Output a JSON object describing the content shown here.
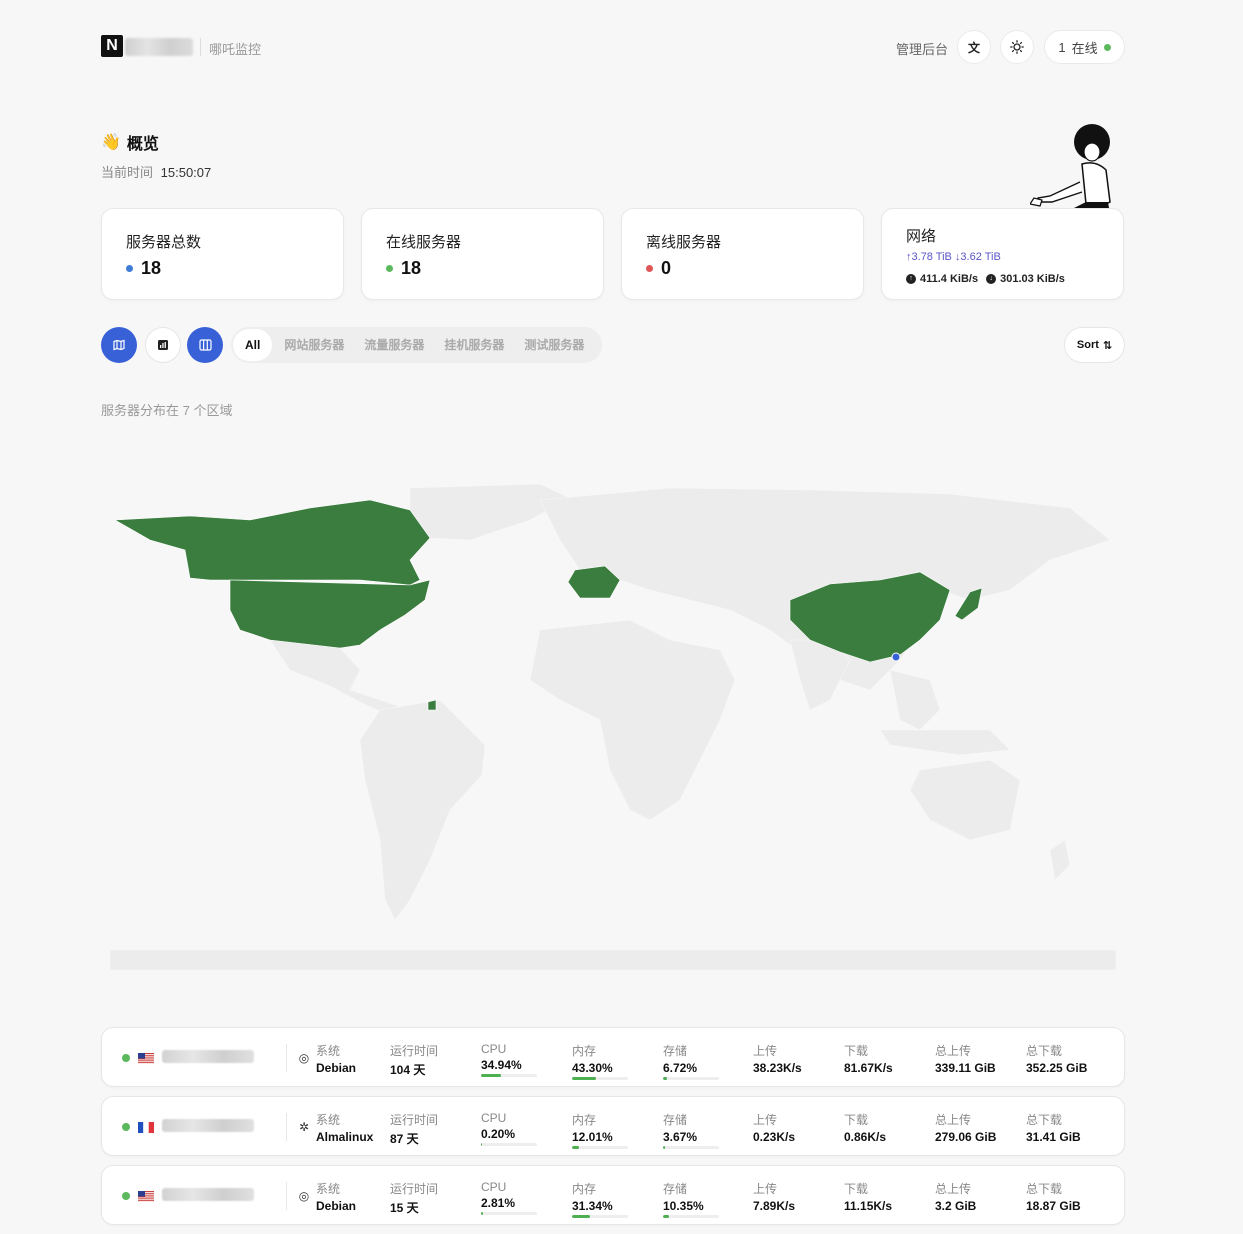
{
  "header": {
    "logo_letter": "N",
    "subtitle": "哪吒监控",
    "admin_label": "管理后台",
    "online_count": "1",
    "online_label": "在线"
  },
  "overview": {
    "emoji": "👋",
    "title": "概览",
    "time_label": "当前时间",
    "time_value": "15:50:07"
  },
  "stats": {
    "total": {
      "label": "服务器总数",
      "value": "18",
      "color": "#3e7bd6"
    },
    "online": {
      "label": "在线服务器",
      "value": "18",
      "color": "#5cb85c"
    },
    "offline": {
      "label": "离线服务器",
      "value": "0",
      "color": "#e05555"
    },
    "network": {
      "label": "网络",
      "upload_total": "↑3.78 TiB",
      "download_total": "↓3.62 TiB",
      "upload_speed": "411.4 KiB/s",
      "download_speed": "301.03 KiB/s"
    }
  },
  "filters": {
    "tabs": [
      "All",
      "网站服务器",
      "流量服务器",
      "挂机服务器",
      "测试服务器"
    ],
    "sort_label": "Sort"
  },
  "map": {
    "region_text": "服务器分布在 7 个区域",
    "highlight_color": "#3b7d3f",
    "base_color": "#ececec"
  },
  "servers": [
    {
      "flag": "us",
      "os_label": "系统",
      "os": "Debian",
      "uptime_label": "运行时间",
      "uptime": "104 天",
      "cpu_label": "CPU",
      "cpu": "34.94%",
      "cpu_pct": 34.94,
      "mem_label": "内存",
      "mem": "43.30%",
      "mem_pct": 43.3,
      "disk_label": "存储",
      "disk": "6.72%",
      "disk_pct": 6.72,
      "up_label": "上传",
      "up": "38.23K/s",
      "down_label": "下载",
      "down": "81.67K/s",
      "total_up_label": "总上传",
      "total_up": "339.11 GiB",
      "total_down_label": "总下载",
      "total_down": "352.25 GiB"
    },
    {
      "flag": "fr",
      "os_label": "系统",
      "os": "Almalinux",
      "uptime_label": "运行时间",
      "uptime": "87 天",
      "cpu_label": "CPU",
      "cpu": "0.20%",
      "cpu_pct": 0.2,
      "mem_label": "内存",
      "mem": "12.01%",
      "mem_pct": 12.01,
      "disk_label": "存储",
      "disk": "3.67%",
      "disk_pct": 3.67,
      "up_label": "上传",
      "up": "0.23K/s",
      "down_label": "下载",
      "down": "0.86K/s",
      "total_up_label": "总上传",
      "total_up": "279.06 GiB",
      "total_down_label": "总下载",
      "total_down": "31.41 GiB"
    },
    {
      "flag": "us",
      "os_label": "系统",
      "os": "Debian",
      "uptime_label": "运行时间",
      "uptime": "15 天",
      "cpu_label": "CPU",
      "cpu": "2.81%",
      "cpu_pct": 2.81,
      "mem_label": "内存",
      "mem": "31.34%",
      "mem_pct": 31.34,
      "disk_label": "存储",
      "disk": "10.35%",
      "disk_pct": 10.35,
      "up_label": "上传",
      "up": "7.89K/s",
      "down_label": "下载",
      "down": "11.15K/s",
      "total_up_label": "总上传",
      "total_up": "3.2 GiB",
      "total_down_label": "总下载",
      "total_down": "18.87 GiB"
    }
  ]
}
